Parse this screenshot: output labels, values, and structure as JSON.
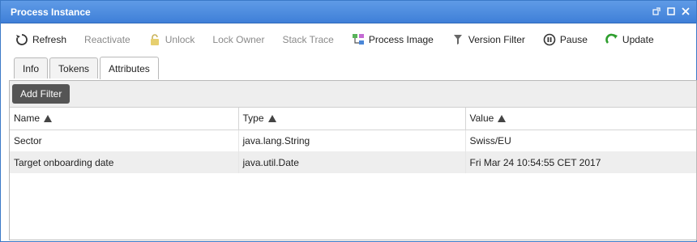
{
  "window": {
    "title": "Process Instance"
  },
  "toolbar": {
    "refresh": "Refresh",
    "reactivate": "Reactivate",
    "unlock": "Unlock",
    "lock_owner": "Lock Owner",
    "stack_trace": "Stack Trace",
    "process_image": "Process Image",
    "version_filter": "Version Filter",
    "pause": "Pause",
    "update": "Update"
  },
  "tabs": [
    {
      "label": "Info"
    },
    {
      "label": "Tokens"
    },
    {
      "label": "Attributes",
      "active": true
    }
  ],
  "filter": {
    "add_label": "Add Filter"
  },
  "table": {
    "columns": [
      "Name",
      "Type",
      "Value"
    ],
    "rows": [
      {
        "name": "Sector",
        "type": "java.lang.String",
        "value": "Swiss/EU"
      },
      {
        "name": "Target onboarding date",
        "type": "java.util.Date",
        "value": "Fri Mar 24 10:54:55 CET 2017"
      }
    ]
  },
  "colors": {
    "titlebar": "#3f7fd8",
    "add_filter_bg": "#555555",
    "update_icon": "#2e9e2e"
  },
  "icons": [
    "refresh-icon",
    "lock-icon",
    "process-image-icon",
    "filter-icon",
    "pause-icon",
    "update-icon",
    "popout-icon",
    "maximize-icon",
    "close-icon",
    "sort-asc-icon"
  ]
}
